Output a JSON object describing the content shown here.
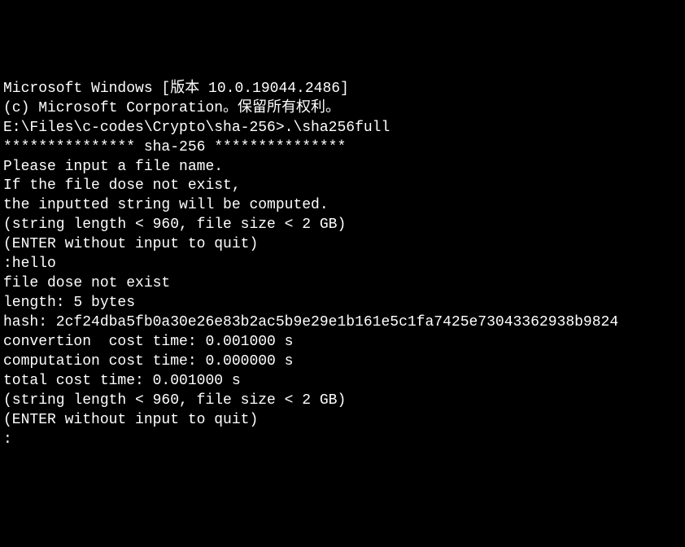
{
  "terminal": {
    "lines": [
      "Microsoft Windows [版本 10.0.19044.2486]",
      "(c) Microsoft Corporation。保留所有权利。",
      "",
      "E:\\Files\\c-codes\\Crypto\\sha-256>.\\sha256full",
      "*************** sha-256 ***************",
      "Please input a file name.",
      "If the file dose not exist,",
      "the inputted string will be computed.",
      "(string length < 960, file size < 2 GB)",
      "(ENTER without input to quit)",
      ":hello",
      "file dose not exist",
      "length: 5 bytes",
      "hash: 2cf24dba5fb0a30e26e83b2ac5b9e29e1b161e5c1fa7425e73043362938b9824",
      "convertion  cost time: 0.001000 s",
      "computation cost time: 0.000000 s",
      "total cost time: 0.001000 s",
      "(string length < 960, file size < 2 GB)",
      "(ENTER without input to quit)",
      ":"
    ]
  }
}
